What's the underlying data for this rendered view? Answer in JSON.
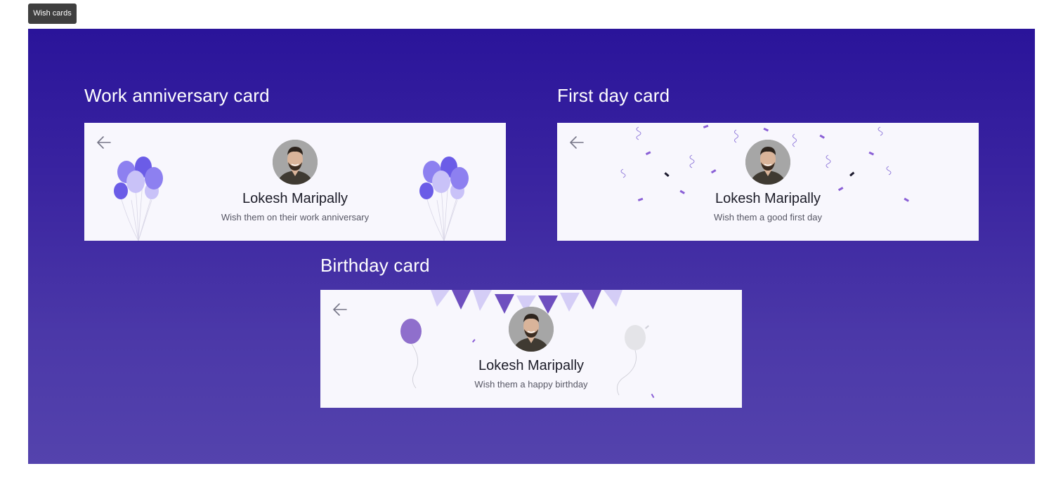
{
  "tab": {
    "label": "Wish cards"
  },
  "colors": {
    "accent": "#2a149a",
    "balloon_primary": "#7b6cf0",
    "balloon_light": "#c9c2f8",
    "confetti": "#8a5fd6",
    "card_bg": "#f8f7fd"
  },
  "cards": {
    "work_anniversary": {
      "title": "Work anniversary card",
      "name": "Lokesh Maripally",
      "subtitle": "Wish them on their work anniversary",
      "icon": "back-arrow-icon"
    },
    "first_day": {
      "title": "First day card",
      "name": "Lokesh Maripally",
      "subtitle": "Wish them a good first day",
      "icon": "back-arrow-icon"
    },
    "birthday": {
      "title": "Birthday card",
      "name": "Lokesh Maripally",
      "subtitle": "Wish them a happy birthday",
      "icon": "back-arrow-icon"
    }
  }
}
